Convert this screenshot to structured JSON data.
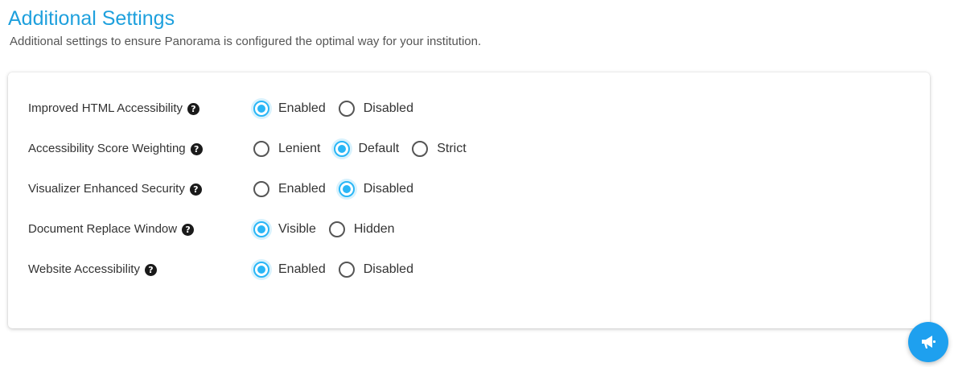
{
  "header": {
    "title": "Additional Settings",
    "subtitle": "Additional settings to ensure Panorama is configured the optimal way for your institution."
  },
  "colors": {
    "accent": "#1ea0dd",
    "radio_checked": "#29b6f6",
    "fab": "#1ea0ef"
  },
  "settings": [
    {
      "label": "Improved HTML Accessibility",
      "help_icon": "question-circle-icon",
      "options": [
        {
          "label": "Enabled",
          "checked": true
        },
        {
          "label": "Disabled",
          "checked": false
        }
      ]
    },
    {
      "label": "Accessibility Score Weighting",
      "help_icon": "question-circle-icon",
      "options": [
        {
          "label": "Lenient",
          "checked": false
        },
        {
          "label": "Default",
          "checked": true
        },
        {
          "label": "Strict",
          "checked": false
        }
      ]
    },
    {
      "label": "Visualizer Enhanced Security",
      "help_icon": "question-circle-icon",
      "options": [
        {
          "label": "Enabled",
          "checked": false
        },
        {
          "label": "Disabled",
          "checked": true
        }
      ]
    },
    {
      "label": "Document Replace Window",
      "help_icon": "question-circle-icon",
      "options": [
        {
          "label": "Visible",
          "checked": true
        },
        {
          "label": "Hidden",
          "checked": false
        }
      ]
    },
    {
      "label": "Website Accessibility",
      "help_icon": "question-circle-icon",
      "options": [
        {
          "label": "Enabled",
          "checked": true
        },
        {
          "label": "Disabled",
          "checked": false
        }
      ]
    }
  ],
  "fab": {
    "icon": "megaphone-icon"
  }
}
